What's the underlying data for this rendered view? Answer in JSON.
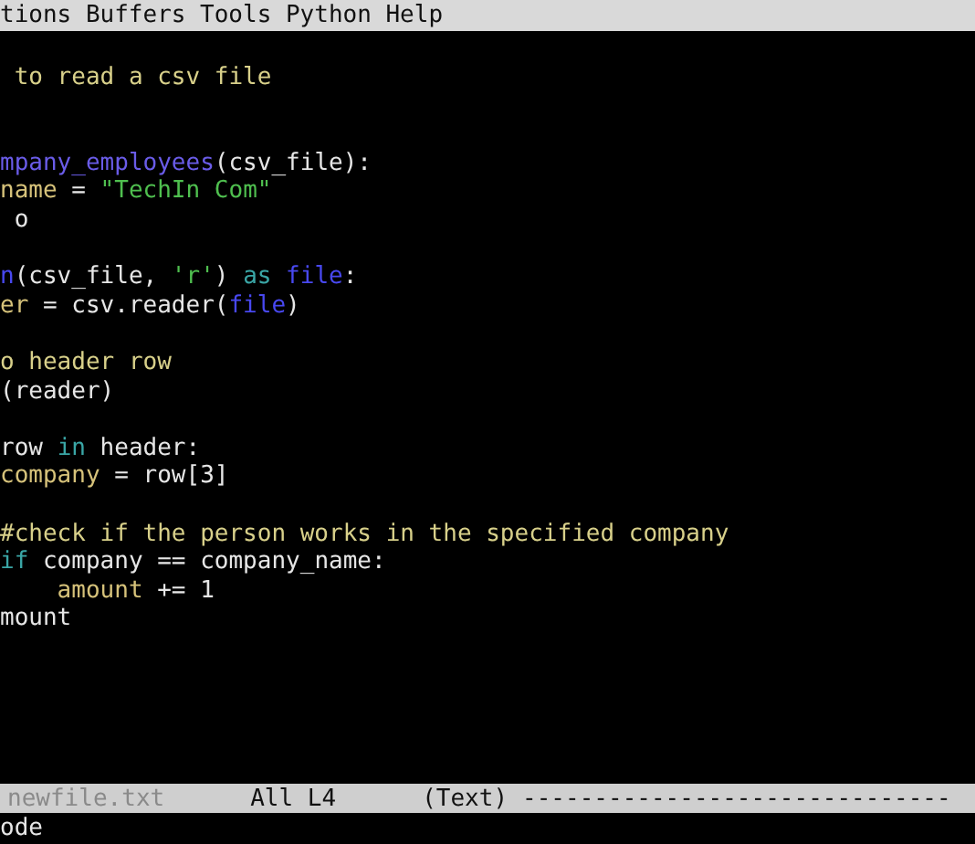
{
  "menu_bar": [
    "tions",
    "Buffers",
    "Tools",
    "Python",
    "Help"
  ],
  "code_lines": [
    {
      "kind": "code",
      "tokens": [
        {
          "kind": "comment",
          "text": " to read a csv file"
        }
      ]
    },
    {
      "kind": "blank"
    },
    {
      "kind": "blank"
    },
    {
      "kind": "code",
      "tokens": [
        {
          "kind": "function",
          "text": "mpany_employees"
        },
        {
          "kind": "plain",
          "text": "(csv_file):"
        }
      ]
    },
    {
      "kind": "code",
      "tokens": [
        {
          "kind": "variable",
          "text": "name"
        },
        {
          "kind": "plain",
          "text": " = "
        },
        {
          "kind": "string",
          "text": "\"TechIn Com\""
        }
      ]
    },
    {
      "kind": "code",
      "tokens": [
        {
          "kind": "plain",
          "text": " o"
        }
      ]
    },
    {
      "kind": "blank"
    },
    {
      "kind": "code",
      "tokens": [
        {
          "kind": "builtin",
          "text": "n"
        },
        {
          "kind": "plain",
          "text": "(csv_file, "
        },
        {
          "kind": "string",
          "text": "'r'"
        },
        {
          "kind": "plain",
          "text": ") "
        },
        {
          "kind": "keyword",
          "text": "as "
        },
        {
          "kind": "builtin",
          "text": "file"
        },
        {
          "kind": "plain",
          "text": ":"
        }
      ]
    },
    {
      "kind": "code",
      "tokens": [
        {
          "kind": "variable",
          "text": "er"
        },
        {
          "kind": "plain",
          "text": " = csv.reader("
        },
        {
          "kind": "builtin",
          "text": "file"
        },
        {
          "kind": "plain",
          "text": ")"
        }
      ]
    },
    {
      "kind": "blank"
    },
    {
      "kind": "code",
      "tokens": [
        {
          "kind": "comment",
          "text": "o header row"
        }
      ]
    },
    {
      "kind": "code",
      "tokens": [
        {
          "kind": "plain",
          "text": "(reader)"
        }
      ]
    },
    {
      "kind": "blank"
    },
    {
      "kind": "code",
      "tokens": [
        {
          "kind": "plain",
          "text": "row "
        },
        {
          "kind": "keyword",
          "text": "in"
        },
        {
          "kind": "plain",
          "text": " header:"
        }
      ]
    },
    {
      "kind": "code",
      "tokens": [
        {
          "kind": "variable",
          "text": "company"
        },
        {
          "kind": "plain",
          "text": " = row[3]"
        }
      ]
    },
    {
      "kind": "blank"
    },
    {
      "kind": "code",
      "tokens": [
        {
          "kind": "comment",
          "text": "#check if the person works in the specified company"
        }
      ]
    },
    {
      "kind": "code",
      "tokens": [
        {
          "kind": "keyword",
          "text": "if"
        },
        {
          "kind": "plain",
          "text": " company == company_name:"
        }
      ]
    },
    {
      "kind": "code",
      "tokens": [
        {
          "kind": "variable",
          "text": "    amount"
        },
        {
          "kind": "plain",
          "text": " += 1"
        }
      ]
    },
    {
      "kind": "code",
      "tokens": [
        {
          "kind": "plain",
          "text": "mount"
        }
      ]
    }
  ],
  "mode_line": {
    "buffer_name": "newfile.txt",
    "position": "All L4",
    "major_mode": "(Text)",
    "filler": "------------------------------"
  },
  "minibuffer": "ode"
}
